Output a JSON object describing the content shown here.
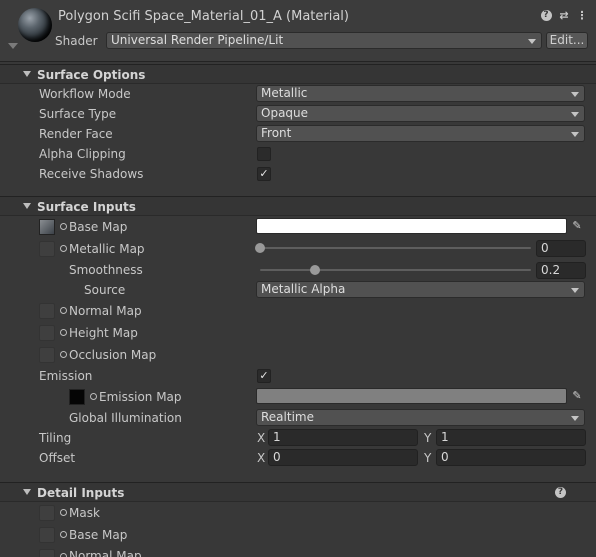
{
  "header": {
    "material_title": "Polygon Scifi Space_Material_01_A (Material)",
    "shader_label": "Shader",
    "shader_value": "Universal Render Pipeline/Lit",
    "edit_button": "Edit...",
    "icons": [
      "help-icon",
      "settings-sliders-icon",
      "context-menu-icon"
    ]
  },
  "surface_options": {
    "title": "Surface Options",
    "workflow_mode": {
      "label": "Workflow Mode",
      "value": "Metallic"
    },
    "surface_type": {
      "label": "Surface Type",
      "value": "Opaque"
    },
    "render_face": {
      "label": "Render Face",
      "value": "Front"
    },
    "alpha_clipping": {
      "label": "Alpha Clipping",
      "checked": false
    },
    "receive_shadows": {
      "label": "Receive Shadows",
      "checked": true
    }
  },
  "surface_inputs": {
    "title": "Surface Inputs",
    "base_map": {
      "label": "Base Map",
      "color": "#ffffff"
    },
    "metallic_map": {
      "label": "Metallic Map",
      "value": "0",
      "slider_fraction": 0
    },
    "smoothness": {
      "label": "Smoothness",
      "value": "0.2",
      "slider_fraction": 0.2
    },
    "source": {
      "label": "Source",
      "value": "Metallic Alpha"
    },
    "normal_map": {
      "label": "Normal Map"
    },
    "height_map": {
      "label": "Height Map"
    },
    "occlusion_map": {
      "label": "Occlusion Map"
    },
    "emission": {
      "label": "Emission",
      "checked": true
    },
    "emission_map": {
      "label": "Emission Map",
      "color": "#808080"
    },
    "global_illumination": {
      "label": "Global Illumination",
      "value": "Realtime"
    },
    "tiling": {
      "label": "Tiling",
      "x_label": "X",
      "x": "1",
      "y_label": "Y",
      "y": "1"
    },
    "offset": {
      "label": "Offset",
      "x_label": "X",
      "x": "0",
      "y_label": "Y",
      "y": "0"
    }
  },
  "detail_inputs": {
    "title": "Detail Inputs",
    "mask": {
      "label": "Mask"
    },
    "base_map": {
      "label": "Base Map"
    },
    "normal_map": {
      "label": "Normal Map"
    }
  },
  "checkmark": "✓",
  "picker_glyph": "✎"
}
